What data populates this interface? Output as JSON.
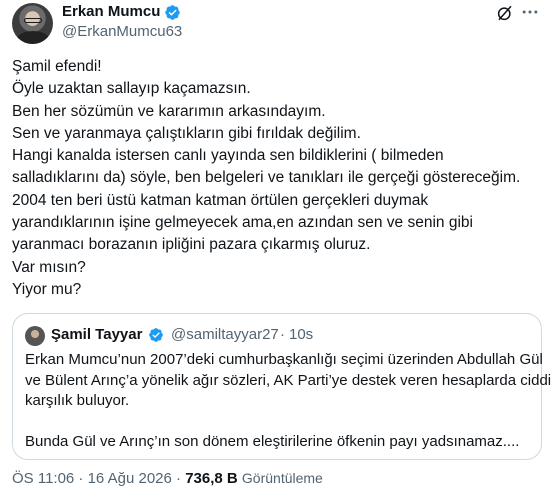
{
  "author": {
    "name": "Erkan Mumcu",
    "handle": "@ErkanMumcu63"
  },
  "tweet_lines": [
    "Şamil efendi!",
    "Öyle uzaktan sallayıp kaçamazsın.",
    "Ben her sözümün ve kararımın arkasındayım.",
    "Sen ve yaranmaya çalıştıkların gibi fırıldak değilim.",
    "Hangi kanalda istersen canlı yayında sen bildiklerini ( bilmeden",
    "salladıklarını da) söyle, ben belgeleri ve tanıkları ile gerçeği göstereceğim.",
    "2004 ten beri üstü katman katman örtülen gerçekleri duymak",
    "yarandıklarının işine gelmeyecek ama,en azından sen ve senin gibi",
    "yaranmacı borazanın ipliğini pazara çıkarmış oluruz.",
    "Var mısın?",
    "Yiyor mu?"
  ],
  "quote": {
    "name": "Şamil Tayyar",
    "handle": "@samiltayyar27",
    "separator": "·",
    "time": "10s",
    "lines": [
      "Erkan Mumcu’nun 2007’deki cumhurbaşkanlığı seçimi üzerinden Abdullah Gül",
      "ve Bülent Arınç’a yönelik ağır sözleri, AK Parti’ye destek veren hesaplarda ciddi",
      "karşılık buluyor."
    ],
    "line2": "Bunda Gül ve Arınç’ın son dönem eleştirilerine öfkenin payı yadsınamaz...."
  },
  "meta": {
    "timestamp": "ÖS 11:06 · 16 Ağu 2026 ·",
    "views": "736,8 B",
    "views_label": "Görüntüleme"
  },
  "colors": {
    "text": "#0f1419",
    "secondary": "#536471",
    "verified": "#1d9bf0",
    "border": "#cfd9de"
  },
  "icons": [
    "verified-badge-icon",
    "grok-icon",
    "more-icon"
  ]
}
